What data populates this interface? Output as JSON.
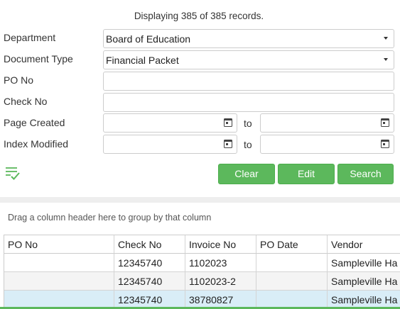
{
  "record_count_text": "Displaying 385 of 385 records.",
  "filters": {
    "department": {
      "label": "Department",
      "value": "Board of Education"
    },
    "document_type": {
      "label": "Document Type",
      "value": "Financial Packet"
    },
    "po_no": {
      "label": "PO No",
      "value": ""
    },
    "check_no": {
      "label": "Check No",
      "value": ""
    },
    "page_created": {
      "label": "Page Created",
      "to_label": "to",
      "from_value": "",
      "to_value": ""
    },
    "index_modified": {
      "label": "Index Modified",
      "to_label": "to",
      "from_value": "",
      "to_value": ""
    }
  },
  "buttons": {
    "clear": "Clear",
    "edit": "Edit",
    "search": "Search"
  },
  "accent_color": "#5cb85c",
  "group_hint": "Drag a column header here to group by that column",
  "grid": {
    "columns": [
      "PO No",
      "Check No",
      "Invoice No",
      "PO Date",
      "Vendor"
    ],
    "rows": [
      [
        "",
        "12345740",
        "1102023",
        "",
        "Sampleville Ha"
      ],
      [
        "",
        "12345740",
        "1102023-2",
        "",
        "Sampleville Ha"
      ],
      [
        "",
        "12345740",
        "38780827",
        "",
        "Sampleville Ha"
      ]
    ]
  }
}
